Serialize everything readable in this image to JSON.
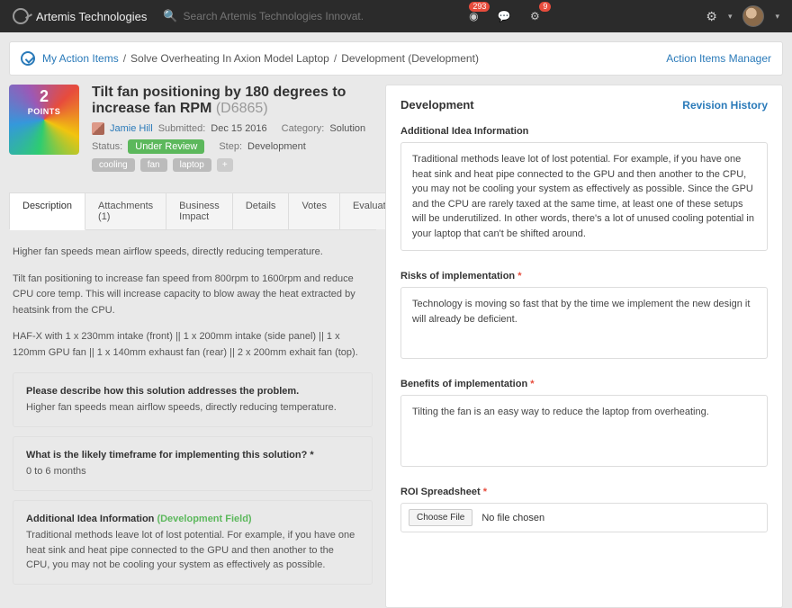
{
  "topbar": {
    "brand": "Artemis Technologies",
    "search_placeholder": "Search Artemis Technologies Innovat...",
    "badges": {
      "alerts": "293",
      "tasks": "9"
    }
  },
  "breadcrumb": {
    "root": "My Action Items",
    "mid": "Solve Overheating In Axion Model Laptop",
    "leaf": "Development (Development)",
    "manager_link": "Action Items Manager"
  },
  "item": {
    "points_value": "2",
    "points_label": "POINTS",
    "title": "Tilt fan positioning by 180 degrees to increase fan RPM",
    "code": "(D6865)",
    "author": "Jamie Hill",
    "submitted_label": "Submitted:",
    "submitted_value": "Dec 15 2016",
    "category_label": "Category:",
    "category_value": "Solution",
    "status_label": "Status:",
    "status_value": "Under Review",
    "step_label": "Step:",
    "step_value": "Development",
    "tags": [
      "cooling",
      "fan",
      "laptop"
    ],
    "add_tag": "+"
  },
  "tabs": {
    "t0": "Description",
    "t1": "Attachments (1)",
    "t2": "Business Impact",
    "t3": "Details",
    "t4": "Votes",
    "t5": "Evaluations",
    "more": "…"
  },
  "description": {
    "p1": "Higher fan speeds mean airflow speeds, directly reducing temperature.",
    "p2": "Tilt fan positioning to increase fan speed from 800rpm to 1600rpm and reduce CPU core temp. This will increase capacity to blow away the heat extracted by heatsink from the CPU.",
    "p3": "HAF-X with 1 x 230mm intake (front) || 1 x 200mm intake (side panel) || 1 x 120mm GPU fan || 1 x 140mm exhaust fan (rear) || 2 x 200mm exhait fan (top)."
  },
  "qa": {
    "q1": "Please describe how this solution addresses the problem.",
    "a1": "Higher fan speeds mean airflow speeds, directly reducing temperature.",
    "q2": "What is the likely timeframe for implementing this solution? *",
    "a2": "0 to 6 months",
    "q3": "Additional Idea Information",
    "q3_tag": "(Development Field)",
    "a3": "Traditional methods leave lot of lost potential. For example, if you have one heat sink and heat pipe connected to the GPU and then another to the CPU, you may not be cooling your system as effectively as possible."
  },
  "right": {
    "title": "Development",
    "revision": "Revision History",
    "sec1_label": "Additional Idea Information",
    "sec1_text": "Traditional methods leave lot of lost potential. For example, if you have one heat sink and heat pipe connected to the GPU and then another to the CPU, you may not be cooling your system as effectively as possible. Since the GPU and the CPU are rarely taxed at the same time, at least one of these setups will be underutilized. In other words, there's a lot of unused cooling potential in your laptop that can't be shifted around.",
    "sec2_label": "Risks of implementation",
    "sec2_text": "Technology is moving so fast that by the time we implement the new design it will already be deficient.",
    "sec3_label": "Benefits of implementation",
    "sec3_text": "Tilting the fan is an easy way to reduce the laptop from overheating.",
    "sec4_label": "ROI Spreadsheet",
    "choose_file": "Choose File",
    "no_file": "No file chosen"
  }
}
